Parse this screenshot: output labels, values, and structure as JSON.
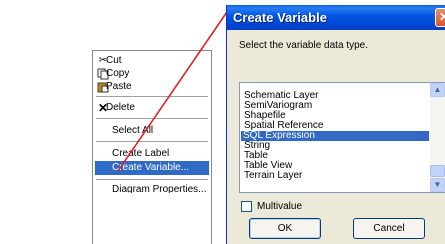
{
  "context_menu": {
    "cut": "Cut",
    "copy": "Copy",
    "paste": "Paste",
    "delete": "Delete",
    "select_all": "Select All",
    "create_label": "Create Label",
    "create_variable": "Create Variable...",
    "diagram_properties": "Diagram Properties..."
  },
  "dialog": {
    "title": "Create Variable",
    "prompt": "Select the variable data type.",
    "list_items": [
      "Schematic Layer",
      "SemiVariogram",
      "Shapefile",
      "Spatial Reference",
      "SQL Expression",
      "String",
      "Table",
      "Table View",
      "Terrain Layer"
    ],
    "selected_item": "SQL Expression",
    "multivalue_label": "Multivalue",
    "multivalue_checked": false,
    "ok_label": "OK",
    "cancel_label": "Cancel"
  },
  "colors": {
    "selection": "#316ac5",
    "connector": "#e0232a",
    "titlebar": "#0054e3",
    "dialog_bg": "#ece9d8"
  }
}
